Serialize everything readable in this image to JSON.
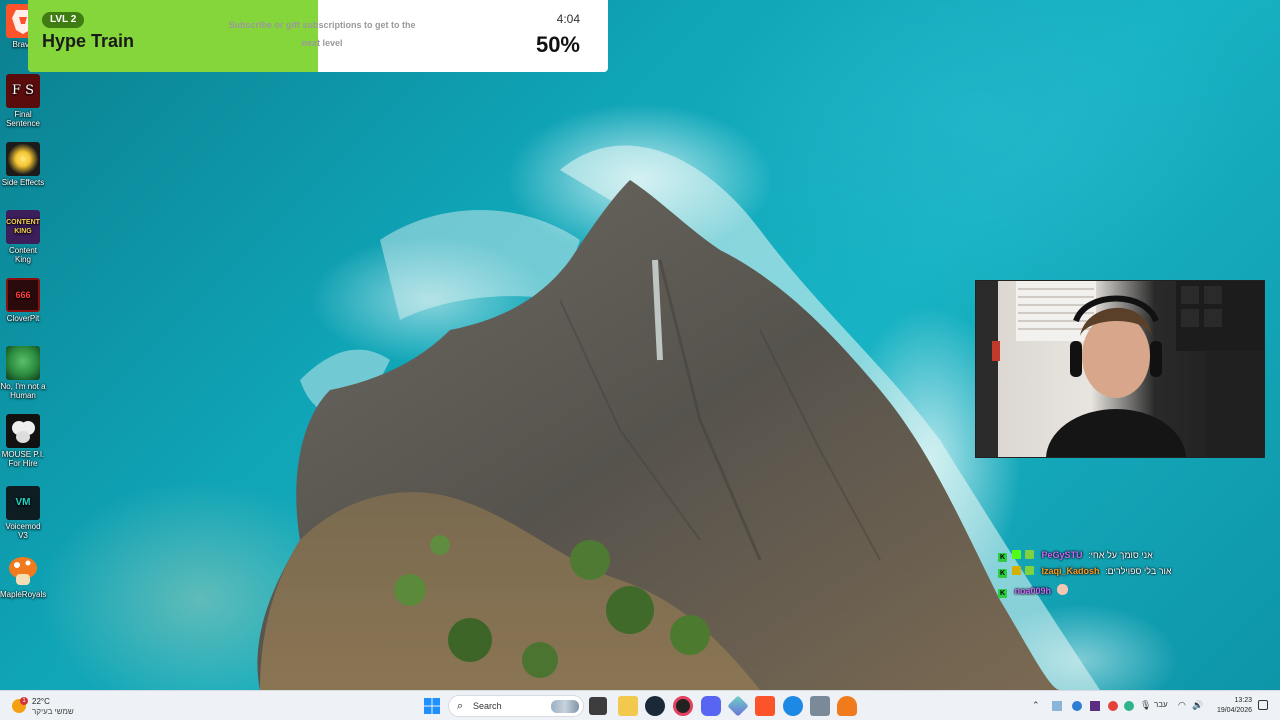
{
  "desktop": {
    "icons": [
      {
        "label": "Brave"
      },
      {
        "label": "Final Sentence",
        "glyph_text": "F S"
      },
      {
        "label": "Side Effects"
      },
      {
        "label": "Content King",
        "glyph_text": "CONTENT KING"
      },
      {
        "label": "CloverPit",
        "glyph_text": "666"
      },
      {
        "label": "No, I'm not a Human"
      },
      {
        "label": "MOUSE P.I. For Hire"
      },
      {
        "label": "Voicemod V3",
        "glyph_text": "VM"
      },
      {
        "label": "MapleRoyals"
      }
    ]
  },
  "hype_train": {
    "level": "LVL 2",
    "title": "Hype Train",
    "description": "Subscribe or gift subscriptions to get to the next level",
    "timer": "4:04",
    "percent_label": "50%",
    "progress": 0.5,
    "color_fill": "#85d63a",
    "color_badge": "#3f7d12"
  },
  "chat": {
    "messages": [
      {
        "user": "PeGySTU",
        "user_color": "#c46cff",
        "text": ":אני סומך על אחי"
      },
      {
        "user": "Izaqi_Kadosh",
        "user_color": "#ff9b1f",
        "text": ":אור בלי ספוילרים"
      },
      {
        "user": "noa009h",
        "user_color": "#c46cff",
        "text": ""
      }
    ]
  },
  "taskbar": {
    "weather": {
      "temp": "22°C",
      "condition": "שמשי בעיקר",
      "notification_count": "1"
    },
    "search": {
      "label": "Search"
    },
    "tray": {
      "language": "עבר"
    },
    "clock": {
      "time": "13:23",
      "date": "19/04/2026"
    }
  }
}
